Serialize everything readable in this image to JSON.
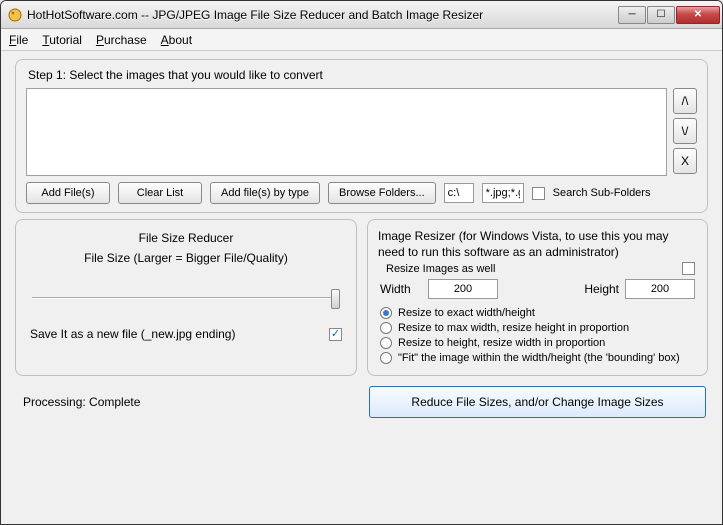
{
  "window": {
    "title": "HotHotSoftware.com -- JPG/JPEG Image File Size Reducer and Batch Image Resizer"
  },
  "menu": {
    "file": "File",
    "tutorial": "Tutorial",
    "purchase": "Purchase",
    "about": "About"
  },
  "step1": {
    "label": "Step 1: Select the images that you would like to convert",
    "move_up": "/\\",
    "move_down": "\\/",
    "remove": "X",
    "add_files": "Add File(s)",
    "clear_list": "Clear List",
    "add_by_type": "Add file(s) by type",
    "browse_folders": "Browse Folders...",
    "path": "c:\\",
    "pattern": "*.jpg;*.g",
    "search_sub": "Search Sub-Folders"
  },
  "reducer": {
    "title": "File Size Reducer",
    "subtitle": "File Size (Larger = Bigger File/Quality)",
    "save_new": "Save It as a new file (_new.jpg ending)",
    "save_new_checked": true
  },
  "resizer": {
    "title": "Image Resizer (for Windows Vista, to use this you may need to run this software as an administrator)",
    "resize_also_label": "Resize Images as well",
    "resize_also_checked": false,
    "width_label": "Width",
    "width_value": "200",
    "height_label": "Height",
    "height_value": "200",
    "opt_exact": "Resize to exact width/height",
    "opt_maxw": "Resize to max width, resize height in proportion",
    "opt_height": "Resize to height, resize width in proportion",
    "opt_fit": "\"Fit\" the image within the width/height (the 'bounding' box)"
  },
  "status": "Processing: Complete",
  "action_button": "Reduce File Sizes, and/or Change Image Sizes"
}
